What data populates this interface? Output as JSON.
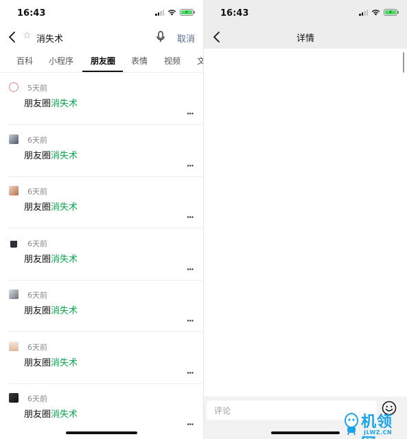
{
  "left": {
    "status": {
      "time": "16:43"
    },
    "search": {
      "query": "消失术",
      "cancel_label": "取消"
    },
    "tabs": [
      {
        "label": "百科"
      },
      {
        "label": "小程序"
      },
      {
        "label": "朋友圈",
        "active": true
      },
      {
        "label": "表情"
      },
      {
        "label": "视频"
      },
      {
        "label": "文"
      }
    ],
    "results": [
      {
        "ago": "5天前",
        "prefix": "朋友圈",
        "match": "消失术",
        "more": "···"
      },
      {
        "ago": "6天前",
        "prefix": "朋友圈",
        "match": "消失术",
        "more": "···"
      },
      {
        "ago": "6天前",
        "prefix": "朋友圈",
        "match": "消失术",
        "more": "···"
      },
      {
        "ago": "6天前",
        "prefix": "朋友圈",
        "match": "消失术",
        "more": "···"
      },
      {
        "ago": "6天前",
        "prefix": "朋友圈",
        "match": "消失术",
        "more": "···"
      },
      {
        "ago": "6天前",
        "prefix": "朋友圈",
        "match": "消失术",
        "more": "···"
      },
      {
        "ago": "6天前",
        "prefix": "朋友圈",
        "match": "消失术",
        "more": "···"
      }
    ]
  },
  "right": {
    "status": {
      "time": "16:43"
    },
    "title": "详情",
    "comment_placeholder": "评论"
  },
  "watermark": {
    "text": "机领网",
    "url": "JLWZ.CN"
  },
  "colors": {
    "highlight": "#07a84e",
    "cancel": "#576b95",
    "header_bg": "#ededed",
    "battery": "#4cd964",
    "watermark": "#1aa3e8"
  },
  "icons": [
    "back-chevron-icon",
    "star-icon",
    "microphone-icon",
    "signal-icon",
    "wifi-icon",
    "battery-charging-icon",
    "emoji-icon"
  ]
}
